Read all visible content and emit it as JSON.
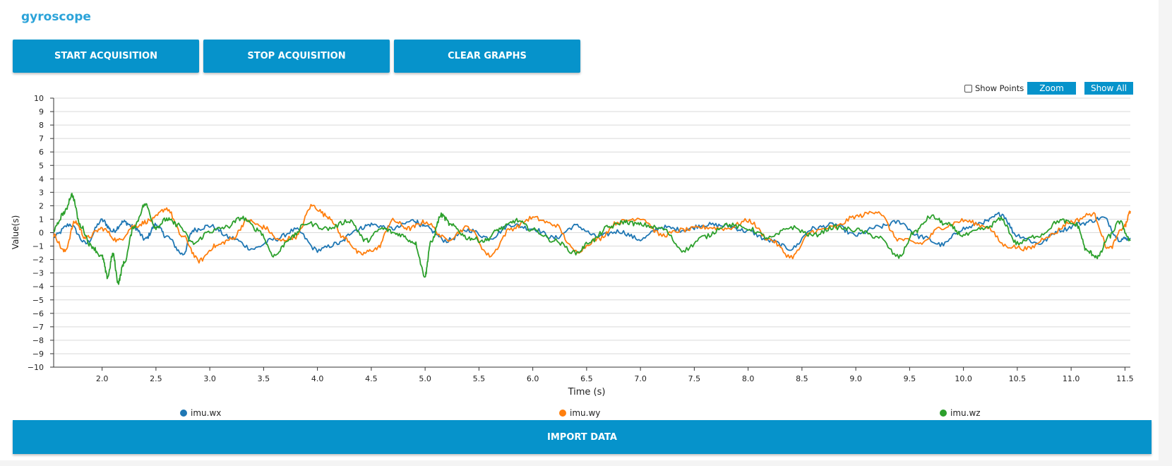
{
  "app": {
    "title": "gyroscope"
  },
  "toolbar": {
    "start_label": "START ACQUISITION",
    "stop_label": "STOP ACQUISITION",
    "clear_label": "CLEAR GRAPHS"
  },
  "chart_controls": {
    "show_points_label": "Show Points",
    "show_points_checked": false,
    "zoom_label": "Zoom",
    "show_all_label": "Show All"
  },
  "footer": {
    "import_label": "IMPORT DATA"
  },
  "colors": {
    "accent": "#0693cb",
    "title": "#2ba3d9"
  },
  "chart_data": {
    "type": "line",
    "xlabel": "Time (s)",
    "ylabel": "Value(s)",
    "xlim": [
      1.55,
      11.55
    ],
    "ylim": [
      -10,
      10
    ],
    "xticks": [
      2.0,
      2.5,
      3.0,
      3.5,
      4.0,
      4.5,
      5.0,
      5.5,
      6.0,
      6.5,
      7.0,
      7.5,
      8.0,
      8.5,
      9.0,
      9.5,
      10.0,
      10.5,
      11.0,
      11.5
    ],
    "yticks": [
      10,
      9,
      8,
      7,
      6,
      5,
      4,
      3,
      2,
      1,
      0,
      -1,
      -2,
      -3,
      -4,
      -5,
      -6,
      -7,
      -8,
      -9,
      -10
    ],
    "grid": true,
    "legend_position": "bottom",
    "series": [
      {
        "name": "imu.wx",
        "color": "#1f77b4",
        "x": [
          1.55,
          1.7,
          1.85,
          2.0,
          2.1,
          2.2,
          2.3,
          2.4,
          2.5,
          2.6,
          2.75,
          2.85,
          3.0,
          3.2,
          3.4,
          3.6,
          3.8,
          4.0,
          4.2,
          4.35,
          4.5,
          4.7,
          4.9,
          5.0,
          5.2,
          5.4,
          5.6,
          5.8,
          6.0,
          6.2,
          6.4,
          6.6,
          6.8,
          7.0,
          7.2,
          7.4,
          7.6,
          7.8,
          8.0,
          8.2,
          8.4,
          8.6,
          8.8,
          9.0,
          9.2,
          9.4,
          9.6,
          9.8,
          10.0,
          10.2,
          10.35,
          10.5,
          10.7,
          10.9,
          11.1,
          11.3,
          11.45,
          11.55
        ],
        "y": [
          -0.3,
          0.6,
          -0.8,
          0.9,
          0.1,
          0.8,
          0.4,
          -0.5,
          0.6,
          -0.3,
          -1.6,
          0.2,
          0.5,
          -0.4,
          -1.2,
          -0.5,
          0.2,
          -1.3,
          -0.8,
          0.2,
          0.6,
          0.3,
          0.9,
          0.4,
          -0.6,
          0.2,
          -0.4,
          0.6,
          0.3,
          -0.4,
          0.5,
          -0.3,
          0.1,
          -0.5,
          0.4,
          0.2,
          0.6,
          0.5,
          0.1,
          -0.6,
          -1.2,
          0.3,
          0.6,
          -0.2,
          0.4,
          0.8,
          -0.3,
          -0.9,
          0.3,
          0.8,
          1.4,
          -0.2,
          -0.8,
          0.2,
          0.7,
          1.1,
          -0.5,
          -0.4
        ]
      },
      {
        "name": "imu.wy",
        "color": "#ff7f0e",
        "x": [
          1.55,
          1.65,
          1.75,
          1.85,
          2.0,
          2.15,
          2.3,
          2.45,
          2.6,
          2.75,
          2.9,
          3.05,
          3.2,
          3.35,
          3.5,
          3.65,
          3.8,
          3.95,
          4.1,
          4.25,
          4.4,
          4.55,
          4.7,
          4.85,
          5.0,
          5.2,
          5.4,
          5.6,
          5.8,
          6.0,
          6.2,
          6.4,
          6.6,
          6.8,
          7.0,
          7.2,
          7.4,
          7.6,
          7.8,
          8.0,
          8.2,
          8.4,
          8.6,
          8.8,
          9.0,
          9.2,
          9.4,
          9.6,
          9.8,
          10.0,
          10.2,
          10.4,
          10.6,
          10.8,
          11.0,
          11.2,
          11.35,
          11.5,
          11.55
        ],
        "y": [
          -0.2,
          -1.4,
          0.8,
          -0.4,
          0.3,
          -0.6,
          0.5,
          0.9,
          1.8,
          -0.3,
          -2.1,
          -1.0,
          -0.5,
          0.9,
          0.4,
          -0.6,
          -0.3,
          2.0,
          1.2,
          -0.4,
          -1.6,
          -1.2,
          0.9,
          0.3,
          0.8,
          -0.5,
          0.4,
          -1.7,
          0.3,
          1.1,
          0.6,
          -1.4,
          -0.5,
          0.8,
          1.1,
          -0.2,
          0.2,
          0.4,
          0.3,
          0.9,
          -0.5,
          -1.8,
          0.1,
          0.4,
          1.2,
          1.6,
          -0.5,
          -0.8,
          0.4,
          0.9,
          0.5,
          -1.0,
          -1.2,
          -0.2,
          0.8,
          1.4,
          -1.2,
          0.5,
          1.6
        ]
      },
      {
        "name": "imu.wz",
        "color": "#2ca02c",
        "x": [
          1.55,
          1.65,
          1.72,
          1.8,
          1.9,
          2.0,
          2.05,
          2.1,
          2.15,
          2.2,
          2.3,
          2.4,
          2.5,
          2.6,
          2.7,
          2.85,
          3.0,
          3.15,
          3.3,
          3.45,
          3.6,
          3.75,
          3.9,
          4.1,
          4.3,
          4.45,
          4.6,
          4.75,
          4.9,
          5.0,
          5.05,
          5.15,
          5.25,
          5.4,
          5.55,
          5.7,
          5.85,
          6.0,
          6.2,
          6.4,
          6.55,
          6.7,
          6.85,
          7.0,
          7.2,
          7.4,
          7.6,
          7.8,
          8.0,
          8.2,
          8.4,
          8.6,
          8.8,
          9.0,
          9.2,
          9.4,
          9.55,
          9.7,
          9.85,
          10.0,
          10.2,
          10.35,
          10.5,
          10.7,
          10.9,
          11.05,
          11.15,
          11.25,
          11.35,
          11.45,
          11.55
        ],
        "y": [
          0.2,
          1.5,
          2.8,
          0.5,
          -1.0,
          -1.8,
          -3.3,
          -1.6,
          -3.7,
          -2.3,
          0.5,
          2.1,
          0.4,
          1.0,
          0.6,
          -0.8,
          0.1,
          0.4,
          1.1,
          0.2,
          -1.7,
          -0.4,
          0.7,
          0.3,
          0.9,
          -0.6,
          0.3,
          -0.1,
          -0.7,
          -3.2,
          -0.8,
          1.3,
          0.5,
          -0.4,
          -0.6,
          0.3,
          0.9,
          0.2,
          -0.6,
          -1.5,
          -0.6,
          0.4,
          0.8,
          0.6,
          0.3,
          -1.3,
          -0.3,
          0.6,
          0.3,
          -0.4,
          0.4,
          -0.2,
          0.4,
          0.2,
          -0.3,
          -1.8,
          0.1,
          1.2,
          0.6,
          -0.2,
          0.3,
          1.0,
          -0.8,
          -0.2,
          0.9,
          0.6,
          -1.4,
          -1.8,
          -0.3,
          0.8,
          -0.6
        ]
      }
    ]
  }
}
